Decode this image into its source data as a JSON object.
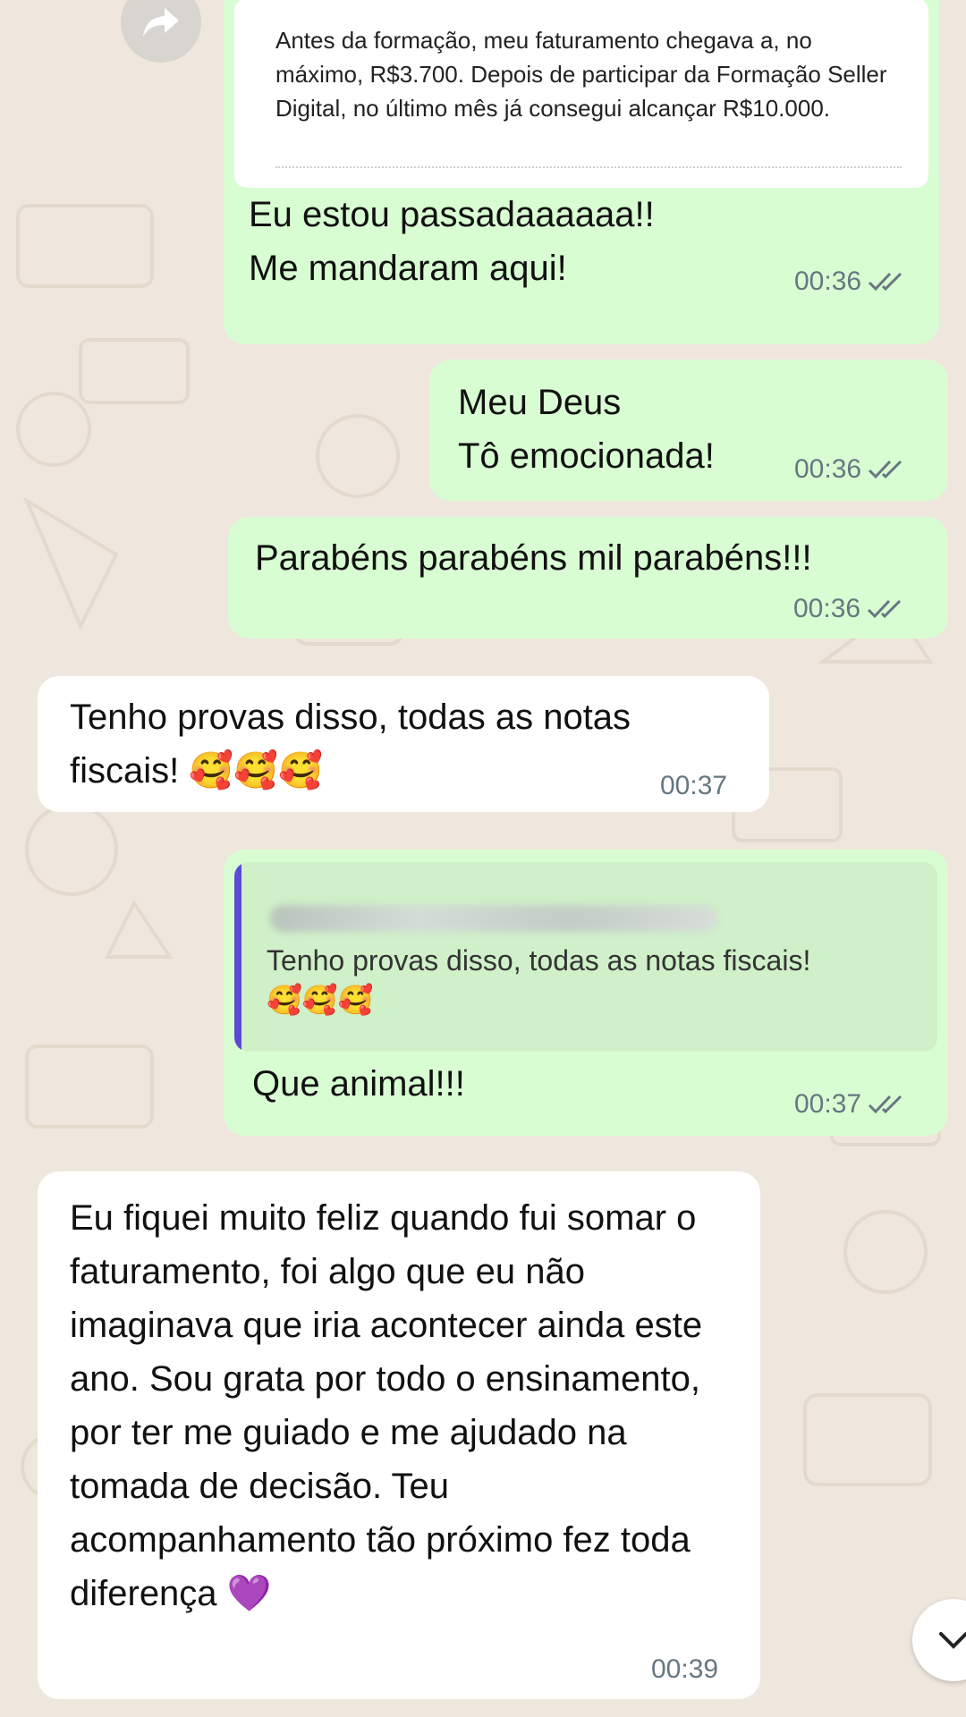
{
  "forward_icon": "forward-arrow-icon",
  "scroll_icon": "chevron-down-icon",
  "messages": [
    {
      "id": "m1",
      "direction": "outgoing",
      "quoted_excerpt": "Antes da formação, meu faturamento chegava a, no máximo, R$3.700. Depois de participar da Formação Seller Digital, no último mês já consegui alcançar R$10.000.",
      "text": "Eu estou passadaaaaaa!!\nMe mandaram aqui!",
      "time": "00:36",
      "status": "read"
    },
    {
      "id": "m2",
      "direction": "outgoing",
      "text": "Meu Deus\nTô emocionada!",
      "time": "00:36",
      "status": "read"
    },
    {
      "id": "m3",
      "direction": "outgoing",
      "text": "Parabéns parabéns mil parabéns!!!",
      "time": "00:36",
      "status": "read"
    },
    {
      "id": "m4",
      "direction": "incoming",
      "text": "Tenho provas disso, todas as notas fiscais! 🥰🥰🥰",
      "time": "00:37"
    },
    {
      "id": "m5",
      "direction": "outgoing",
      "reply_to": {
        "text": "Tenho provas disso, todas as notas fiscais!",
        "emojis": "🥰🥰🥰"
      },
      "text": "Que animal!!!",
      "time": "00:37",
      "status": "read"
    },
    {
      "id": "m6",
      "direction": "incoming",
      "text": "Eu fiquei muito feliz quando fui somar o faturamento, foi algo que eu não imaginava que iria acontecer ainda este ano. Sou grata por todo o ensinamento, por ter me guiado e me ajudado na tomada de decisão. Teu acompanhamento tão próximo fez toda diferença 💜",
      "time": "00:39"
    }
  ],
  "colors": {
    "outgoing_bubble": "#d9fdd3",
    "incoming_bubble": "#ffffff",
    "wallpaper": "#efe7de",
    "read_ticks": "#667781",
    "reply_accent": "#5a4bd6"
  }
}
